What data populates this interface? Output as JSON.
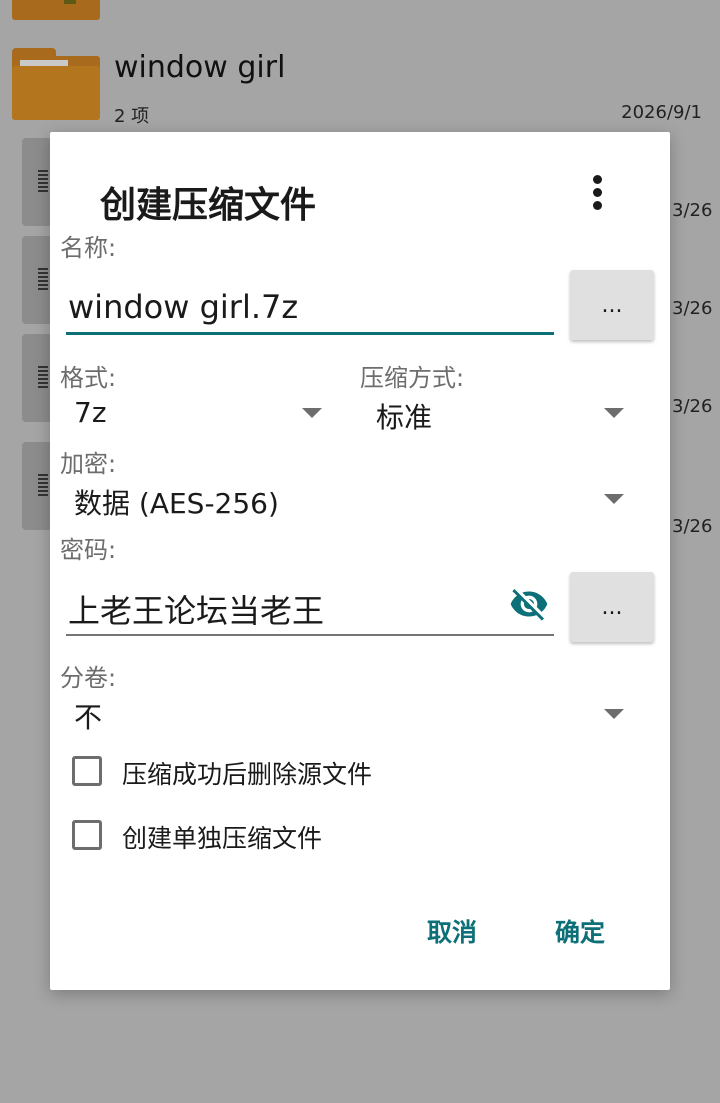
{
  "background": {
    "folder_name": "window girl",
    "folder_count": "2 项",
    "folder_date": "2026/9/1",
    "file_dates": [
      "3/26",
      "3/26",
      "3/26",
      "3/26"
    ]
  },
  "dialog": {
    "title": "创建压缩文件",
    "name_label": "名称:",
    "name_value": "window girl.7z",
    "browse_label": "...",
    "format_label": "格式:",
    "format_value": "7z",
    "method_label": "压缩方式:",
    "method_value": "标准",
    "encryption_label": "加密:",
    "encryption_value": "数据 (AES-256)",
    "password_label": "密码:",
    "password_value": "上老王论坛当老王",
    "password_more_label": "...",
    "split_label": "分卷:",
    "split_value": "不",
    "checkbox_delete_label": "压缩成功后删除源文件",
    "checkbox_separate_label": "创建单独压缩文件",
    "cancel_label": "取消",
    "ok_label": "确定"
  },
  "colors": {
    "accent": "#0d6f78",
    "scrim": "#a5a5a5",
    "folder": "#a86a1c"
  }
}
